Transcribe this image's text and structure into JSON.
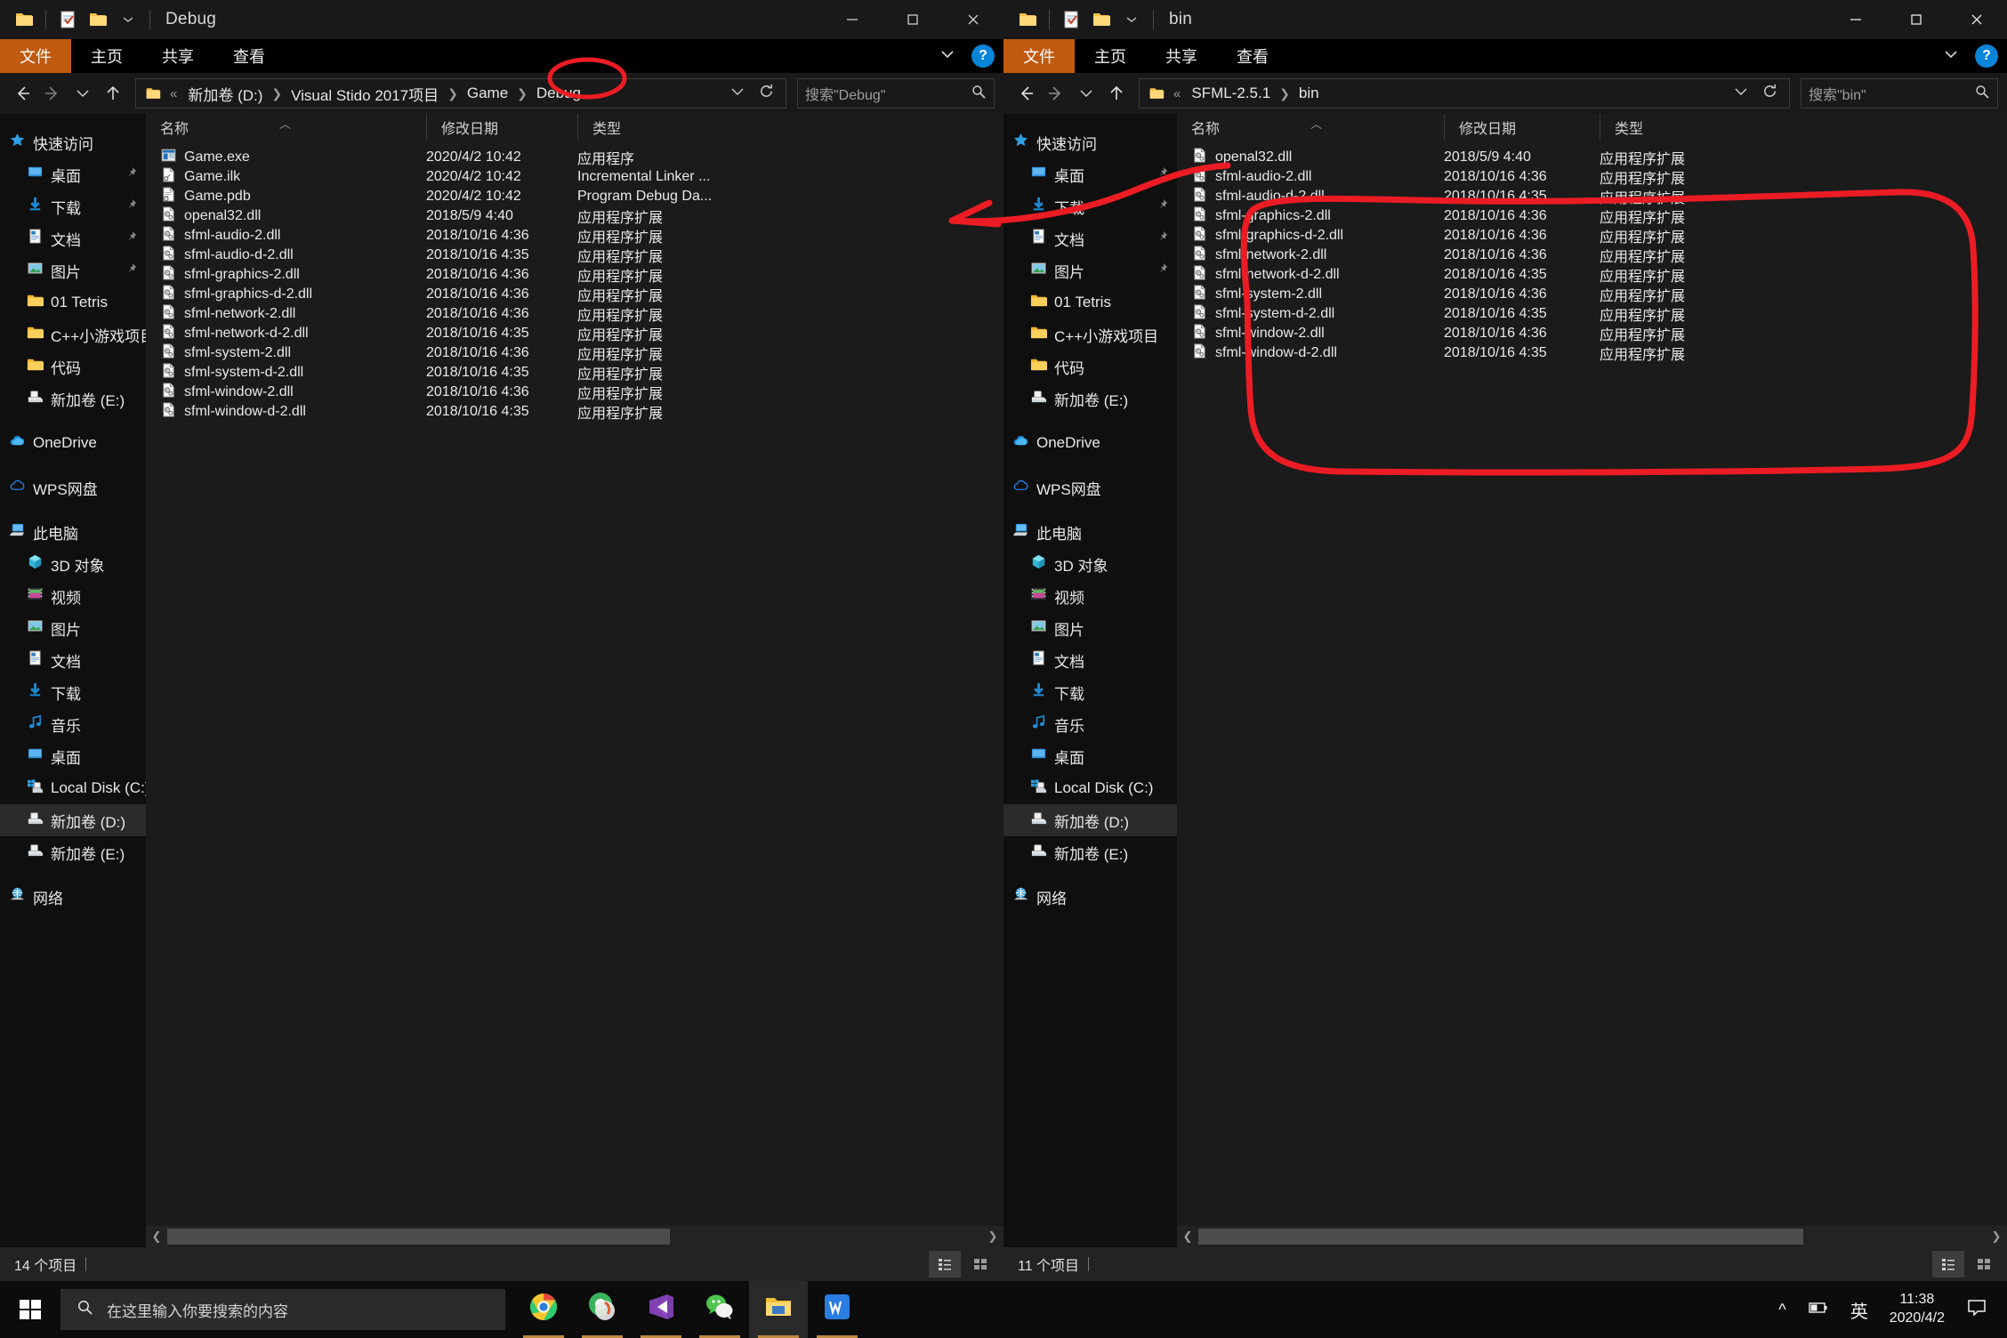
{
  "left_window": {
    "title": "Debug",
    "quick_access_icons": [
      "folder-icon",
      "properties-icon",
      "new-folder-icon",
      "chevron-down-icon"
    ],
    "window_controls": {
      "minimize": "—",
      "maximize": "□",
      "close": "✕"
    },
    "ribbon_tabs": [
      {
        "label": "文件",
        "active": true
      },
      {
        "label": "主页",
        "active": false
      },
      {
        "label": "共享",
        "active": false
      },
      {
        "label": "查看",
        "active": false
      }
    ],
    "breadcrumb": [
      "新加卷 (D:)",
      "Visual Stido 2017项目",
      "Game",
      "Debug"
    ],
    "search_placeholder": "搜索\"Debug\"",
    "columns": [
      "名称",
      "修改日期",
      "类型"
    ],
    "files": [
      {
        "name": "Game.exe",
        "date": "2020/4/2 10:42",
        "type": "应用程序",
        "icon": "exe-icon"
      },
      {
        "name": "Game.ilk",
        "date": "2020/4/2 10:42",
        "type": "Incremental Linker ...",
        "icon": "ilk-icon"
      },
      {
        "name": "Game.pdb",
        "date": "2020/4/2 10:42",
        "type": "Program Debug Da...",
        "icon": "pdb-icon"
      },
      {
        "name": "openal32.dll",
        "date": "2018/5/9 4:40",
        "type": "应用程序扩展",
        "icon": "dll-icon"
      },
      {
        "name": "sfml-audio-2.dll",
        "date": "2018/10/16 4:36",
        "type": "应用程序扩展",
        "icon": "dll-icon"
      },
      {
        "name": "sfml-audio-d-2.dll",
        "date": "2018/10/16 4:35",
        "type": "应用程序扩展",
        "icon": "dll-icon"
      },
      {
        "name": "sfml-graphics-2.dll",
        "date": "2018/10/16 4:36",
        "type": "应用程序扩展",
        "icon": "dll-icon"
      },
      {
        "name": "sfml-graphics-d-2.dll",
        "date": "2018/10/16 4:36",
        "type": "应用程序扩展",
        "icon": "dll-icon"
      },
      {
        "name": "sfml-network-2.dll",
        "date": "2018/10/16 4:36",
        "type": "应用程序扩展",
        "icon": "dll-icon"
      },
      {
        "name": "sfml-network-d-2.dll",
        "date": "2018/10/16 4:35",
        "type": "应用程序扩展",
        "icon": "dll-icon"
      },
      {
        "name": "sfml-system-2.dll",
        "date": "2018/10/16 4:36",
        "type": "应用程序扩展",
        "icon": "dll-icon"
      },
      {
        "name": "sfml-system-d-2.dll",
        "date": "2018/10/16 4:35",
        "type": "应用程序扩展",
        "icon": "dll-icon"
      },
      {
        "name": "sfml-window-2.dll",
        "date": "2018/10/16 4:36",
        "type": "应用程序扩展",
        "icon": "dll-icon"
      },
      {
        "name": "sfml-window-d-2.dll",
        "date": "2018/10/16 4:35",
        "type": "应用程序扩展",
        "icon": "dll-icon"
      }
    ],
    "nav_items": [
      {
        "label": "快速访问",
        "icon": "star-icon",
        "level": 0,
        "pinned": false,
        "selected": false
      },
      {
        "label": "桌面",
        "icon": "desktop-icon",
        "level": 1,
        "pinned": true,
        "selected": false
      },
      {
        "label": "下载",
        "icon": "download-icon",
        "level": 1,
        "pinned": true,
        "selected": false
      },
      {
        "label": "文档",
        "icon": "document-icon",
        "level": 1,
        "pinned": true,
        "selected": false
      },
      {
        "label": "图片",
        "icon": "picture-icon",
        "level": 1,
        "pinned": true,
        "selected": false
      },
      {
        "label": "01 Tetris",
        "icon": "folder-icon",
        "level": 1,
        "pinned": false,
        "selected": false
      },
      {
        "label": "C++小游戏项目",
        "icon": "folder-icon",
        "level": 1,
        "pinned": false,
        "selected": false
      },
      {
        "label": "代码",
        "icon": "folder-icon",
        "level": 1,
        "pinned": false,
        "selected": false
      },
      {
        "label": "新加卷 (E:)",
        "icon": "drive-icon",
        "level": 1,
        "pinned": false,
        "selected": false
      },
      {
        "label": "__GAP__",
        "icon": "",
        "level": 0,
        "pinned": false,
        "selected": false
      },
      {
        "label": "OneDrive",
        "icon": "onedrive-icon",
        "level": 0,
        "pinned": false,
        "selected": false
      },
      {
        "label": "__GAP__",
        "icon": "",
        "level": 0,
        "pinned": false,
        "selected": false
      },
      {
        "label": "WPS网盘",
        "icon": "wps-cloud-icon",
        "level": 0,
        "pinned": false,
        "selected": false
      },
      {
        "label": "__GAP__",
        "icon": "",
        "level": 0,
        "pinned": false,
        "selected": false
      },
      {
        "label": "此电脑",
        "icon": "pc-icon",
        "level": 0,
        "pinned": false,
        "selected": false
      },
      {
        "label": "3D 对象",
        "icon": "3d-icon",
        "level": 1,
        "pinned": false,
        "selected": false
      },
      {
        "label": "视频",
        "icon": "video-icon",
        "level": 1,
        "pinned": false,
        "selected": false
      },
      {
        "label": "图片",
        "icon": "picture-icon",
        "level": 1,
        "pinned": false,
        "selected": false
      },
      {
        "label": "文档",
        "icon": "document-icon",
        "level": 1,
        "pinned": false,
        "selected": false
      },
      {
        "label": "下载",
        "icon": "download-icon",
        "level": 1,
        "pinned": false,
        "selected": false
      },
      {
        "label": "音乐",
        "icon": "music-icon",
        "level": 1,
        "pinned": false,
        "selected": false
      },
      {
        "label": "桌面",
        "icon": "desktop-icon",
        "level": 1,
        "pinned": false,
        "selected": false
      },
      {
        "label": "Local Disk (C:)",
        "icon": "windisk-icon",
        "level": 1,
        "pinned": false,
        "selected": false
      },
      {
        "label": "新加卷 (D:)",
        "icon": "drive-icon",
        "level": 1,
        "pinned": false,
        "selected": true
      },
      {
        "label": "新加卷 (E:)",
        "icon": "drive-icon",
        "level": 1,
        "pinned": false,
        "selected": false
      },
      {
        "label": "__GAP__",
        "icon": "",
        "level": 0,
        "pinned": false,
        "selected": false
      },
      {
        "label": "网络",
        "icon": "network-icon",
        "level": 0,
        "pinned": false,
        "selected": false
      }
    ],
    "status": "14 个项目"
  },
  "right_window": {
    "title": "bin",
    "window_controls": {
      "minimize": "—",
      "maximize": "□",
      "close": "✕"
    },
    "ribbon_tabs": [
      {
        "label": "文件",
        "active": true
      },
      {
        "label": "主页",
        "active": false
      },
      {
        "label": "共享",
        "active": false
      },
      {
        "label": "查看",
        "active": false
      }
    ],
    "breadcrumb": [
      "SFML-2.5.1",
      "bin"
    ],
    "search_placeholder": "搜索\"bin\"",
    "columns": [
      "名称",
      "修改日期",
      "类型"
    ],
    "files": [
      {
        "name": "openal32.dll",
        "date": "2018/5/9 4:40",
        "type": "应用程序扩展",
        "icon": "dll-icon"
      },
      {
        "name": "sfml-audio-2.dll",
        "date": "2018/10/16 4:36",
        "type": "应用程序扩展",
        "icon": "dll-icon"
      },
      {
        "name": "sfml-audio-d-2.dll",
        "date": "2018/10/16 4:35",
        "type": "应用程序扩展",
        "icon": "dll-icon"
      },
      {
        "name": "sfml-graphics-2.dll",
        "date": "2018/10/16 4:36",
        "type": "应用程序扩展",
        "icon": "dll-icon"
      },
      {
        "name": "sfml-graphics-d-2.dll",
        "date": "2018/10/16 4:36",
        "type": "应用程序扩展",
        "icon": "dll-icon"
      },
      {
        "name": "sfml-network-2.dll",
        "date": "2018/10/16 4:36",
        "type": "应用程序扩展",
        "icon": "dll-icon"
      },
      {
        "name": "sfml-network-d-2.dll",
        "date": "2018/10/16 4:35",
        "type": "应用程序扩展",
        "icon": "dll-icon"
      },
      {
        "name": "sfml-system-2.dll",
        "date": "2018/10/16 4:36",
        "type": "应用程序扩展",
        "icon": "dll-icon"
      },
      {
        "name": "sfml-system-d-2.dll",
        "date": "2018/10/16 4:35",
        "type": "应用程序扩展",
        "icon": "dll-icon"
      },
      {
        "name": "sfml-window-2.dll",
        "date": "2018/10/16 4:36",
        "type": "应用程序扩展",
        "icon": "dll-icon"
      },
      {
        "name": "sfml-window-d-2.dll",
        "date": "2018/10/16 4:35",
        "type": "应用程序扩展",
        "icon": "dll-icon"
      }
    ],
    "nav_items": [
      {
        "label": "快速访问",
        "icon": "star-icon",
        "level": 0,
        "pinned": false,
        "selected": false
      },
      {
        "label": "桌面",
        "icon": "desktop-icon",
        "level": 1,
        "pinned": true,
        "selected": false
      },
      {
        "label": "下载",
        "icon": "download-icon",
        "level": 1,
        "pinned": true,
        "selected": false
      },
      {
        "label": "文档",
        "icon": "document-icon",
        "level": 1,
        "pinned": true,
        "selected": false
      },
      {
        "label": "图片",
        "icon": "picture-icon",
        "level": 1,
        "pinned": true,
        "selected": false
      },
      {
        "label": "01 Tetris",
        "icon": "folder-icon",
        "level": 1,
        "pinned": false,
        "selected": false
      },
      {
        "label": "C++小游戏项目",
        "icon": "folder-icon",
        "level": 1,
        "pinned": false,
        "selected": false
      },
      {
        "label": "代码",
        "icon": "folder-icon",
        "level": 1,
        "pinned": false,
        "selected": false
      },
      {
        "label": "新加卷 (E:)",
        "icon": "drive-icon",
        "level": 1,
        "pinned": false,
        "selected": false
      },
      {
        "label": "__GAP__",
        "icon": "",
        "level": 0,
        "pinned": false,
        "selected": false
      },
      {
        "label": "OneDrive",
        "icon": "onedrive-icon",
        "level": 0,
        "pinned": false,
        "selected": false
      },
      {
        "label": "__GAP__",
        "icon": "",
        "level": 0,
        "pinned": false,
        "selected": false
      },
      {
        "label": "WPS网盘",
        "icon": "wps-cloud-icon",
        "level": 0,
        "pinned": false,
        "selected": false
      },
      {
        "label": "__GAP__",
        "icon": "",
        "level": 0,
        "pinned": false,
        "selected": false
      },
      {
        "label": "此电脑",
        "icon": "pc-icon",
        "level": 0,
        "pinned": false,
        "selected": false
      },
      {
        "label": "3D 对象",
        "icon": "3d-icon",
        "level": 1,
        "pinned": false,
        "selected": false
      },
      {
        "label": "视频",
        "icon": "video-icon",
        "level": 1,
        "pinned": false,
        "selected": false
      },
      {
        "label": "图片",
        "icon": "picture-icon",
        "level": 1,
        "pinned": false,
        "selected": false
      },
      {
        "label": "文档",
        "icon": "document-icon",
        "level": 1,
        "pinned": false,
        "selected": false
      },
      {
        "label": "下载",
        "icon": "download-icon",
        "level": 1,
        "pinned": false,
        "selected": false
      },
      {
        "label": "音乐",
        "icon": "music-icon",
        "level": 1,
        "pinned": false,
        "selected": false
      },
      {
        "label": "桌面",
        "icon": "desktop-icon",
        "level": 1,
        "pinned": false,
        "selected": false
      },
      {
        "label": "Local Disk (C:)",
        "icon": "windisk-icon",
        "level": 1,
        "pinned": false,
        "selected": false
      },
      {
        "label": "新加卷 (D:)",
        "icon": "drive-icon",
        "level": 1,
        "pinned": false,
        "selected": true
      },
      {
        "label": "新加卷 (E:)",
        "icon": "drive-icon",
        "level": 1,
        "pinned": false,
        "selected": false
      },
      {
        "label": "__GAP__",
        "icon": "",
        "level": 0,
        "pinned": false,
        "selected": false
      },
      {
        "label": "网络",
        "icon": "network-icon",
        "level": 0,
        "pinned": false,
        "selected": false
      }
    ],
    "status": "11 个项目"
  },
  "taskbar": {
    "start_icon": "windows-logo-icon",
    "search_placeholder": "在这里输入你要搜索的内容",
    "search_icon": "search-icon",
    "apps": [
      {
        "name": "chrome-icon",
        "active": false,
        "running": true
      },
      {
        "name": "360-browser-icon",
        "active": false,
        "running": true
      },
      {
        "name": "visual-studio-icon",
        "active": false,
        "running": true
      },
      {
        "name": "wechat-icon",
        "active": false,
        "running": true
      },
      {
        "name": "file-explorer-icon",
        "active": true,
        "running": true
      },
      {
        "name": "wps-icon",
        "active": false,
        "running": true
      }
    ],
    "tray": {
      "chevron_up": "^",
      "battery_icon": "battery-icon",
      "ime": "英",
      "time": "11:38",
      "date": "2020/4/2",
      "notification_icon": "notification-icon"
    }
  },
  "annotations": {
    "color": "#ec1c24",
    "marks": [
      {
        "name": "debug-crumb-circle",
        "shape": "ellipse"
      },
      {
        "name": "type-column-arrow",
        "shape": "arrow"
      },
      {
        "name": "dll-list-enclosure",
        "shape": "lasso"
      }
    ]
  }
}
